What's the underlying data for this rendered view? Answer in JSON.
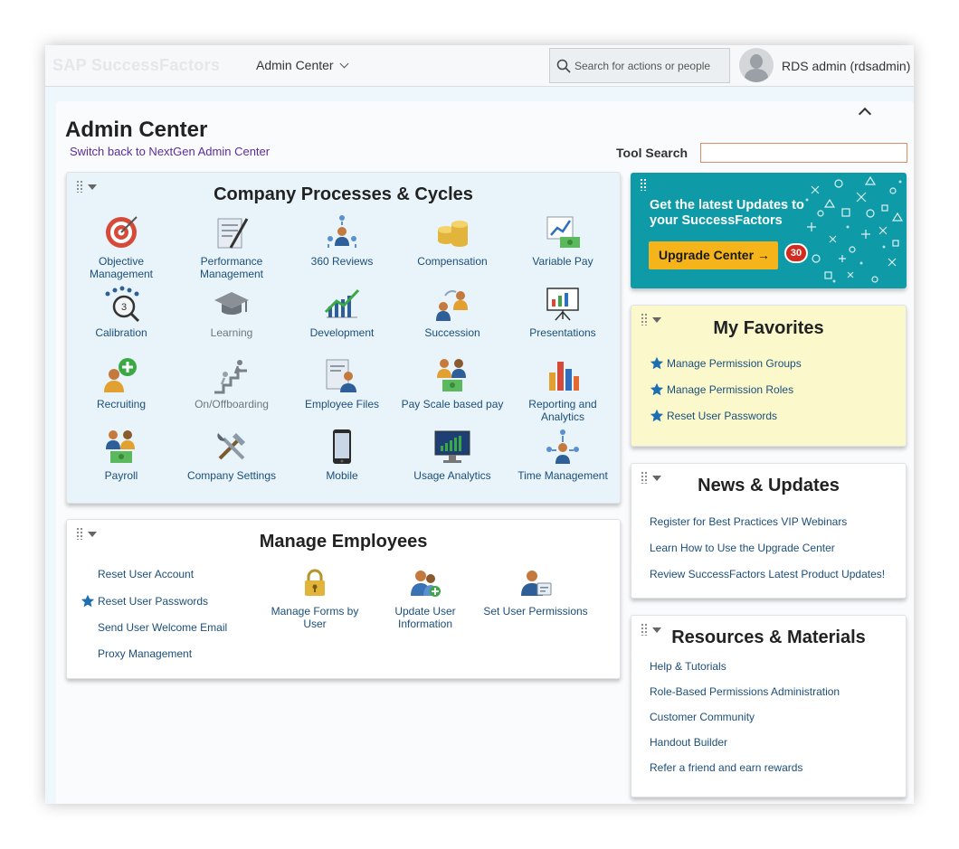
{
  "header": {
    "logo": "SAP SuccessFactors",
    "module": "Admin Center",
    "search_placeholder": "Search for actions or people",
    "user": "RDS admin (rdsadmin)"
  },
  "page": {
    "title": "Admin Center",
    "switch_link": "Switch back to NextGen Admin Center",
    "tool_search_label": "Tool Search",
    "tool_search_value": ""
  },
  "processes": {
    "title": "Company Processes & Cycles",
    "items": [
      {
        "label": "Objective Management",
        "icon": "target-icon"
      },
      {
        "label": "Performance Management",
        "icon": "document-pen-icon"
      },
      {
        "label": "360 Reviews",
        "icon": "people-circle-icon"
      },
      {
        "label": "Compensation",
        "icon": "coins-icon"
      },
      {
        "label": "Variable Pay",
        "icon": "chart-money-icon"
      },
      {
        "label": "Calibration",
        "icon": "magnifier-people-icon"
      },
      {
        "label": "Learning",
        "icon": "graduation-cap-icon"
      },
      {
        "label": "Development",
        "icon": "growth-people-icon"
      },
      {
        "label": "Succession",
        "icon": "succession-icon"
      },
      {
        "label": "Presentations",
        "icon": "presentation-board-icon"
      },
      {
        "label": "Recruiting",
        "icon": "add-person-icon"
      },
      {
        "label": "On/Offboarding",
        "icon": "stairs-icon"
      },
      {
        "label": "Employee Files",
        "icon": "employee-file-icon"
      },
      {
        "label": "Pay Scale based pay",
        "icon": "people-money-icon"
      },
      {
        "label": "Reporting and Analytics",
        "icon": "bar-chart-icon"
      },
      {
        "label": "Payroll",
        "icon": "payroll-icon"
      },
      {
        "label": "Company Settings",
        "icon": "tools-icon"
      },
      {
        "label": "Mobile",
        "icon": "mobile-phone-icon"
      },
      {
        "label": "Usage Analytics",
        "icon": "monitor-chart-icon"
      },
      {
        "label": "Time Management",
        "icon": "time-people-icon"
      }
    ]
  },
  "employees": {
    "title": "Manage Employees",
    "links": [
      "Reset User Account",
      "Reset User Passwords",
      "Send User Welcome Email",
      "Proxy Management"
    ],
    "tiles": [
      "Manage Forms by User",
      "Update User Information",
      "Set User Permissions"
    ]
  },
  "banner": {
    "text": "Get the latest Updates to your SuccessFactors",
    "button": "Upgrade Center",
    "badge": "30"
  },
  "favorites": {
    "title": "My Favorites",
    "items": [
      "Manage Permission Groups",
      "Manage Permission Roles",
      "Reset User Passwords"
    ]
  },
  "news": {
    "title": "News & Updates",
    "items": [
      "Register for Best Practices VIP Webinars",
      "Learn How to Use the Upgrade Center",
      "Review SuccessFactors Latest Product Updates!"
    ]
  },
  "resources": {
    "title": "Resources & Materials",
    "items": [
      "Help & Tutorials",
      "Role-Based Permissions Administration",
      "Customer Community",
      "Handout Builder",
      "Refer a friend and earn rewards"
    ]
  },
  "colors": {
    "accent": "#0e9aa7",
    "link": "#1b4e7a",
    "button": "#f4b41a",
    "badge": "#d22b1f",
    "favorites_bg": "#fbf9cc"
  }
}
